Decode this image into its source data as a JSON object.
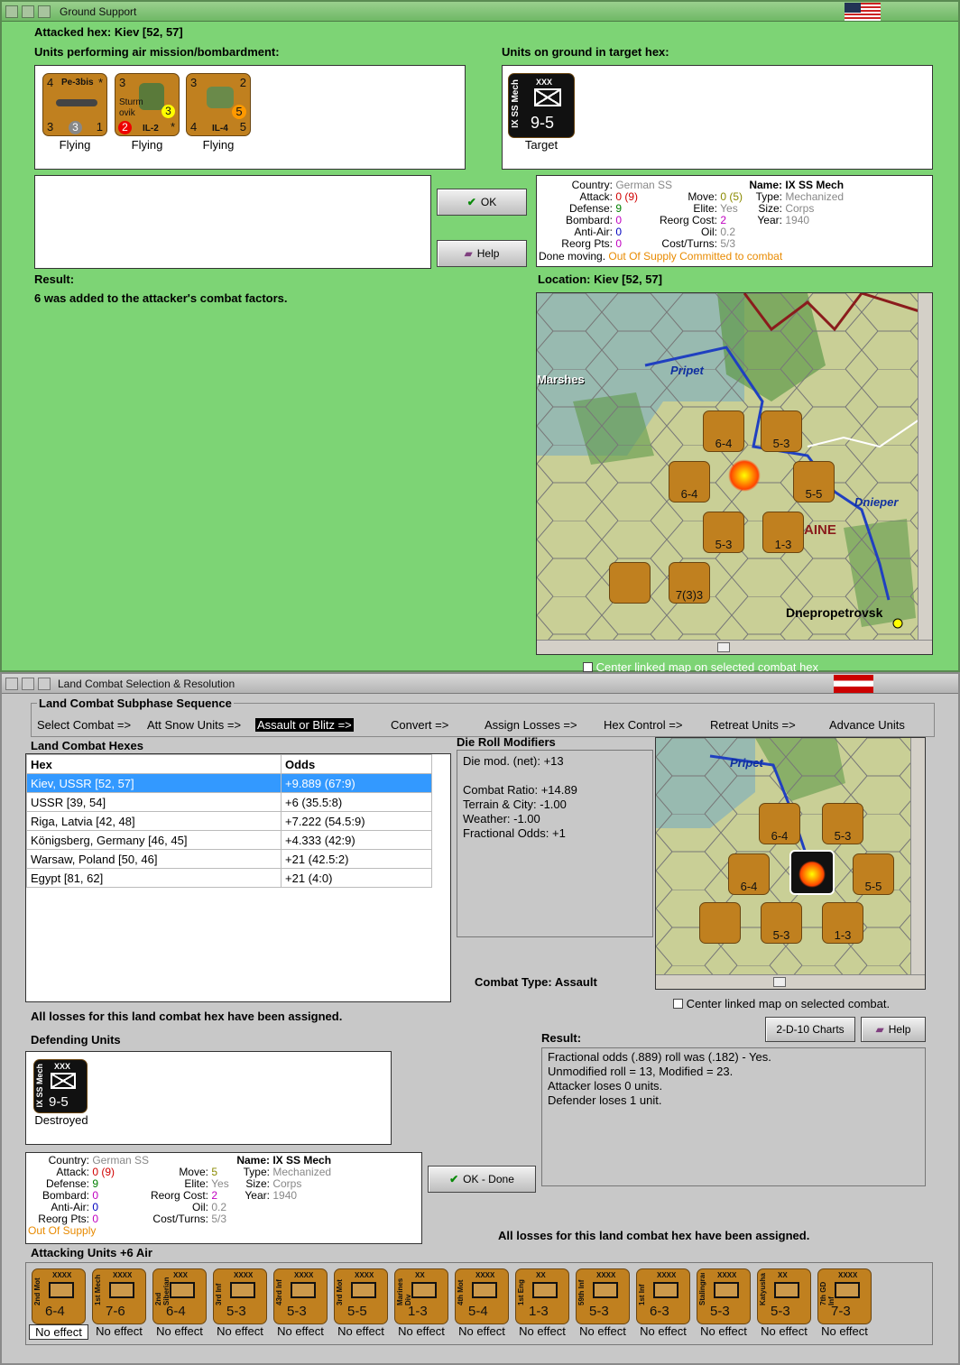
{
  "ground_window": {
    "title": "Ground Support",
    "attacked_hex": "Attacked hex: Kiev  [52, 57]",
    "air_units_heading": "Units performing air mission/bombardment:",
    "ground_units_heading": "Units on ground in target hex:",
    "air_units": [
      {
        "name": "Pe-3bis",
        "tl": "4",
        "tr": "*",
        "bl": "3",
        "bc": "3",
        "br": "1",
        "status": "Flying"
      },
      {
        "name": "IL-2",
        "line1": "Sturm",
        "line2": "ovik",
        "tl": "3",
        "mid": "3",
        "bl": "2",
        "br": "*",
        "status": "Flying"
      },
      {
        "name": "IL-4",
        "tl": "3",
        "tr": "2",
        "bl": "4",
        "mid": "5",
        "br": "5",
        "status": "Flying"
      }
    ],
    "ground_units": [
      {
        "side": "IX SS Mech",
        "size": "XXX",
        "value": "9-5",
        "status": "Target"
      }
    ],
    "ok_label": "OK",
    "help_label": "Help",
    "unit_info": {
      "country_label": "Country:",
      "country": "German SS",
      "attack_label": "Attack:",
      "attack": "0",
      "attack_paren": "(9)",
      "defense_label": "Defense:",
      "defense": "9",
      "bombard_label": "Bombard:",
      "bombard": "0",
      "antiair_label": "Anti-Air:",
      "antiair": "0",
      "reorg_pts_label": "Reorg Pts:",
      "reorg_pts": "0",
      "move_label": "Move:",
      "move": "0",
      "move_paren": "(5)",
      "elite_label": "Elite:",
      "elite": "Yes",
      "reorg_cost_label": "Reorg Cost:",
      "reorg_cost": "2",
      "oil_label": "Oil:",
      "oil": "0.2",
      "cost_label": "Cost/Turns:",
      "cost": "5/3",
      "name_label": "Name:",
      "name": "IX SS Mech",
      "type_label": "Type:",
      "type": "Mechanized",
      "size_label": "Size:",
      "size": "Corps",
      "year_label": "Year:",
      "year": "1940",
      "done": "Done moving.",
      "supply": "Out Of Supply",
      "committed": "Committed to combat"
    },
    "result_heading": "Result:",
    "result_text": "6 was added to the attacker's combat factors.",
    "location": "Location:  Kiev  [52, 57]",
    "map_labels": {
      "marshes": "Marshes",
      "pripet": "Pripet",
      "dnieper": "Dnieper",
      "city": "Dnepropetrovsk",
      "region": "AINE"
    },
    "map_counters": [
      "6-4",
      "5-3",
      "6-4",
      "5-5",
      "5-3",
      "1-3",
      "7(3)3"
    ],
    "center_checkbox": "Center linked map on selected combat hex"
  },
  "land_window": {
    "title": "Land Combat Selection & Resolution",
    "sequence_heading": "Land Combat Subphase Sequence",
    "sequence": [
      "Select Combat =>",
      "Att Snow Units =>",
      "Assault or Blitz =>",
      "Convert =>",
      "Assign Losses =>",
      "Hex Control =>",
      "Retreat Units =>",
      "Advance Units"
    ],
    "hexes_heading": "Land Combat Hexes",
    "col_hex": "Hex",
    "col_odds": "Odds",
    "hexes": [
      {
        "hex": "Kiev, USSR [52, 57]",
        "odds": "+9.889 (67:9)"
      },
      {
        "hex": "USSR [39, 54]",
        "odds": "+6 (35.5:8)"
      },
      {
        "hex": "Riga, Latvia [42, 48]",
        "odds": "+7.222 (54.5:9)"
      },
      {
        "hex": "Königsberg, Germany [46, 45]",
        "odds": "+4.333 (42:9)"
      },
      {
        "hex": "Warsaw, Poland [50, 46]",
        "odds": "+21 (42.5:2)"
      },
      {
        "hex": "Egypt [81, 62]",
        "odds": "+21 (4:0)"
      }
    ],
    "drm_heading": "Die Roll Modifiers",
    "drm": [
      "Die mod. (net): +13",
      "",
      "Combat Ratio: +14.89",
      "Terrain & City: -1.00",
      "Weather: -1.00",
      "Fractional Odds: +1"
    ],
    "combat_type": "Combat Type:  Assault",
    "center_checkbox": "Center linked map on selected combat.",
    "losses_msg": "All losses for this land combat hex have been assigned.",
    "defending_heading": "Defending Units",
    "defender": {
      "side": "IX SS Mech",
      "size": "XXX",
      "value": "9-5",
      "status": "Destroyed"
    },
    "charts_label": "2-D-10 Charts",
    "help_label": "Help",
    "result_heading": "Result:",
    "result_lines": [
      "Fractional odds (.889) roll was (.182)  - Yes.",
      "Unmodified roll = 13, Modified = 23.",
      "Attacker loses 0 units.",
      "Defender loses 1 unit."
    ],
    "ok_done": "OK - Done",
    "unit_info": {
      "country_label": "Country:",
      "country": "German SS",
      "attack_label": "Attack:",
      "attack": "0",
      "attack_paren": "(9)",
      "defense_label": "Defense:",
      "defense": "9",
      "bombard_label": "Bombard:",
      "bombard": "0",
      "antiair_label": "Anti-Air:",
      "antiair": "0",
      "reorg_pts_label": "Reorg Pts:",
      "reorg_pts": "0",
      "move_label": "Move:",
      "move": "5",
      "elite_label": "Elite:",
      "elite": "Yes",
      "reorg_cost_label": "Reorg Cost:",
      "reorg_cost": "2",
      "oil_label": "Oil:",
      "oil": "0.2",
      "cost_label": "Cost/Turns:",
      "cost": "5/3",
      "name_label": "Name:",
      "name": "IX SS Mech",
      "type_label": "Type:",
      "type": "Mechanized",
      "size_label": "Size:",
      "size": "Corps",
      "year_label": "Year:",
      "year": "1940",
      "supply": "Out Of Supply"
    },
    "losses_msg2": "All losses for this land combat hex have been assigned.",
    "attacking_heading": "Attacking Units +6 Air",
    "attackers": [
      {
        "side": "2nd Mot",
        "size": "XXXX",
        "value": "6-4",
        "status": "No effect"
      },
      {
        "side": "1st Mech",
        "size": "XXXX",
        "value": "7-6",
        "status": "No effect"
      },
      {
        "side": "2nd Siberian",
        "size": "XXX",
        "value": "6-4",
        "status": "No effect"
      },
      {
        "side": "3rd Inf",
        "size": "XXXX",
        "value": "5-3",
        "status": "No effect"
      },
      {
        "side": "43rd Inf",
        "size": "XXXX",
        "value": "5-3",
        "status": "No effect"
      },
      {
        "side": "3rd Mot",
        "size": "XXXX",
        "value": "5-5",
        "status": "No effect"
      },
      {
        "side": "Marines Div",
        "size": "XX",
        "value": "1-3",
        "status": "No effect"
      },
      {
        "side": "4th Mot",
        "size": "XXXX",
        "value": "5-4",
        "status": "No effect"
      },
      {
        "side": "1st Eng",
        "size": "XX",
        "value": "1-3",
        "status": "No effect"
      },
      {
        "side": "59th Inf",
        "size": "XXXX",
        "value": "5-3",
        "status": "No effect"
      },
      {
        "side": "1st Inf",
        "size": "XXXX",
        "value": "6-3",
        "status": "No effect"
      },
      {
        "side": "Stalingrad",
        "size": "XXXX",
        "value": "5-3",
        "status": "No effect"
      },
      {
        "side": "Katyusha",
        "size": "XX",
        "value": "5-3",
        "status": "No effect"
      },
      {
        "side": "7th GD Inf",
        "size": "XXXX",
        "value": "7-3",
        "status": "No effect"
      }
    ]
  }
}
